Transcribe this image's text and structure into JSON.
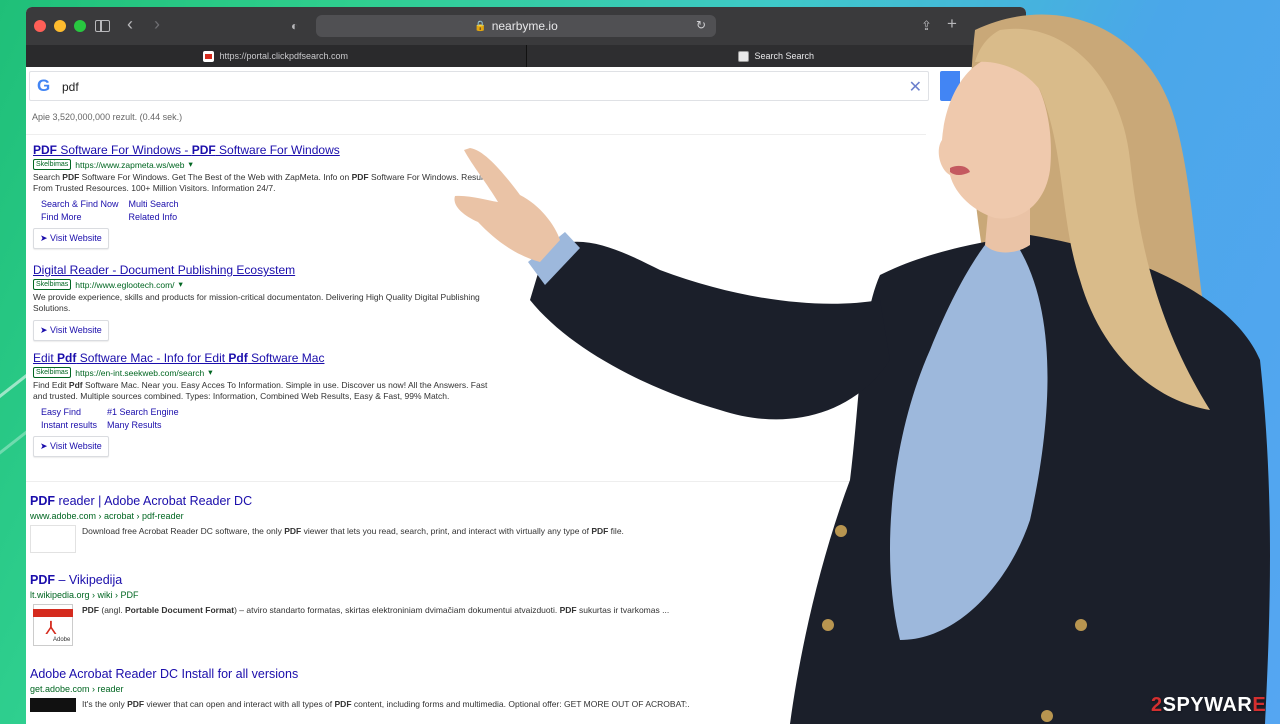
{
  "browser": {
    "address": "nearbyme.io",
    "tabs": [
      {
        "label": "https://portal.clickpdfsearch.com"
      },
      {
        "label": "Search Search"
      }
    ]
  },
  "search": {
    "query": "pdf",
    "stats": "Apie 3,520,000,000 rezult. (0.44 sek.)"
  },
  "ads": [
    {
      "title": "PDF Software For Windows - PDF Software For Windows",
      "badge": "Skelbimas",
      "url": "https://www.zapmeta.ws/web",
      "desc": "Search PDF Software For Windows. Get The Best of the Web with ZapMeta. Info on PDF Software For Windows. Results From Trusted Resources. 100+ Million Visitors. Information 24/7.",
      "sitelinks": [
        "Search & Find Now",
        "Multi Search",
        "Find More",
        "Related Info"
      ],
      "visit": "Visit Website"
    },
    {
      "title": "Digital Reader - Document Publishing Ecosystem",
      "badge": "Skelbimas",
      "url": "http://www.eglootech.com/",
      "desc": "We provide experience, skills and products for mission-critical documentaton. Delivering High Quality Digital Publishing Solutions.",
      "sitelinks": [],
      "visit": "Visit Website"
    },
    {
      "title": "Edit Pdf Software Mac - Info for Edit Pdf Software Mac",
      "badge": "Skelbimas",
      "url": "https://en-int.seekweb.com/search",
      "desc": "Find Edit Pdf Software Mac. Near you. Easy Acces To Information. Simple in use. Discover us now! All the Answers. Fast and trusted. Multiple sources combined. Types: Information, Combined Web Results, Easy & Fast, 99% Match.",
      "sitelinks": [
        "Easy Find",
        "#1 Search Engine",
        "Instant results",
        "Many Results"
      ],
      "visit": "Visit Website"
    }
  ],
  "organic": [
    {
      "title": "PDF reader | Adobe Acrobat Reader DC",
      "url": "www.adobe.com › acrobat › pdf-reader",
      "desc": "Download free Acrobat Reader DC software, the only PDF viewer that lets you read, search, print, and interact with virtually any type of PDF file."
    },
    {
      "title": "PDF – Vikipedija",
      "url": "lt.wikipedia.org › wiki › PDF",
      "desc": "PDF (angl. Portable Document Format) – atviro standarto formatas, skirtas elektroniniam dvimačiam dokumentui atvaizduoti. PDF sukurtas ir tvarkomas ...",
      "thumb_label": "Adobe"
    },
    {
      "title": "Adobe Acrobat Reader DC Install for all versions",
      "url": "get.adobe.com › reader",
      "desc": "It's the only PDF viewer that can open and interact with all types of PDF content, including forms and multimedia. Optional offer: GET MORE OUT OF ACROBAT:."
    }
  ],
  "watermark": {
    "num": "2",
    "text": "SPYWAR",
    "tail": "E"
  }
}
